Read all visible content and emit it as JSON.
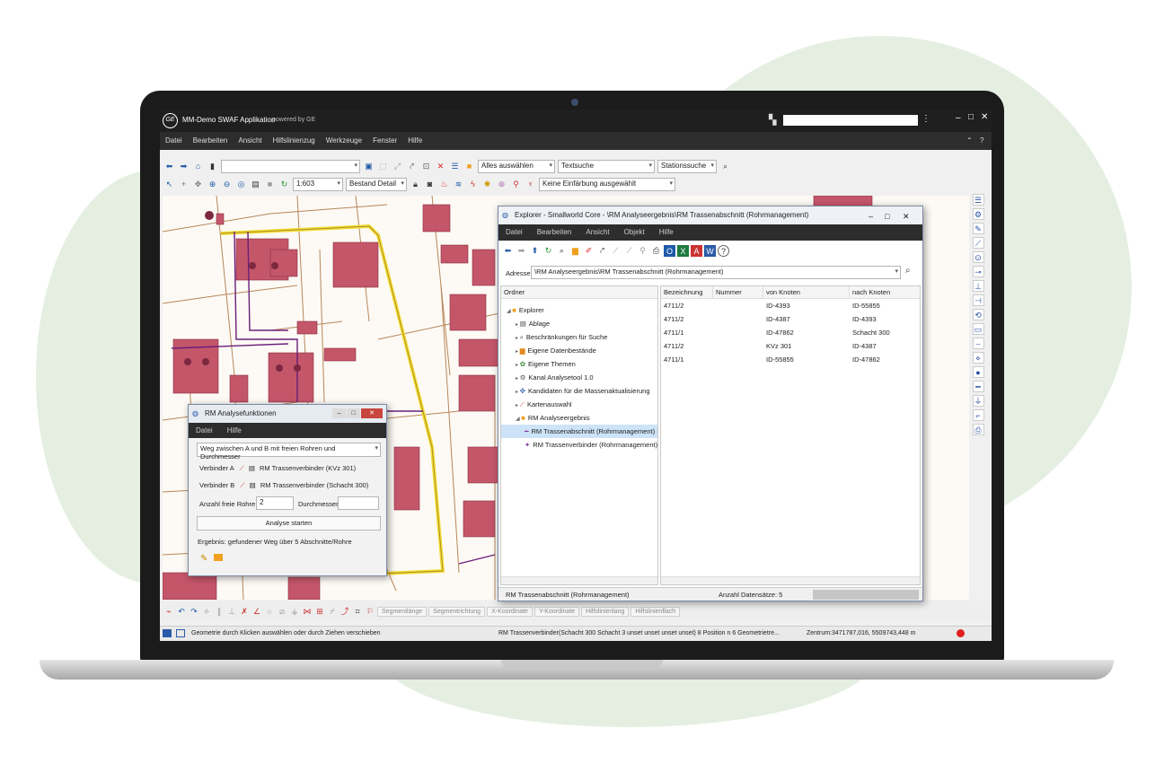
{
  "app": {
    "title": "MM-Demo SWAF Applikation",
    "subtitle": "powered by GE",
    "logo": "GE",
    "menu": [
      "Datei",
      "Bearbeiten",
      "Ansicht",
      "Hilfslinienzug",
      "Werkzeuge",
      "Fenster",
      "Hilfe"
    ]
  },
  "toolbar1": {
    "select_all": "Alles auswählen",
    "text_search": "Textsuche",
    "station_search": "Stationssuche"
  },
  "toolbar2": {
    "scale": "1:603",
    "view": "Bestand Detail",
    "coloring": "Keine Einfärbung ausgewählt"
  },
  "bottom_toolbar": {
    "tabs": [
      "Segmentlänge",
      "Segmentrichtung",
      "X-Koordinate",
      "Y-Koordinate",
      "Hilfslinienlang",
      "Hilfslinienflach"
    ]
  },
  "status": {
    "left": "Geometrie durch Klicken auswählen oder durch Ziehen verschieben",
    "middle": "RM Trassenverbinder(Schacht 300 Schacht 3 unset unset unset unset) 8 Position n 6 Geometrietre...",
    "right": "Zentrum:3471787,016, 5509743,448 m"
  },
  "analysis": {
    "title": "RM Analysefunktionen",
    "menu": [
      "Datei",
      "Hilfe"
    ],
    "mode": "Weg zwischen A und B mit freien Rohren und Durchmesser",
    "connector_a_label": "Verbinder A",
    "connector_a_value": "RM Trassenverbinder (KVz 301)",
    "connector_b_label": "Verbinder B",
    "connector_b_value": "RM Trassenverbinder (Schacht 300)",
    "free_pipes_label": "Anzahl freie Rohre",
    "free_pipes_value": "2",
    "diameter_label": "Durchmesser",
    "diameter_value": "",
    "start_button": "Analyse starten",
    "result": "Ergebnis: gefundener Weg über 5 Abschnitte/Rohre"
  },
  "explorer": {
    "title": "Explorer - Smallworld Core - \\RM Analyseergebnis\\RM Trassenabschnitt (Rohrmanagement)",
    "menu": [
      "Datei",
      "Bearbeiten",
      "Ansicht",
      "Objekt",
      "Hilfe"
    ],
    "address_label": "Adresse",
    "address": "\\RM Analyseergebnis\\RM Trassenabschnitt (Rohrmanagement)",
    "folder_header": "Ordner",
    "tree": [
      {
        "label": "Explorer",
        "icon": "folder-icon",
        "level": 0
      },
      {
        "label": "Ablage",
        "icon": "stack-icon",
        "level": 1
      },
      {
        "label": "Beschränkungen für Suche",
        "icon": "search-icon",
        "level": 1
      },
      {
        "label": "Eigene Datenbestände",
        "icon": "database-icon",
        "level": 1
      },
      {
        "label": "Eigene Themen",
        "icon": "themes-icon",
        "level": 1
      },
      {
        "label": "Kanal Analysetool 1.0",
        "icon": "network-icon",
        "level": 1
      },
      {
        "label": "Kandidaten für die Massenaktualisierung",
        "icon": "candidates-icon",
        "level": 1
      },
      {
        "label": "Kartenauswahl",
        "icon": "map-select-icon",
        "level": 1
      },
      {
        "label": "RM Analyseergebnis",
        "icon": "folder-icon",
        "level": 1
      },
      {
        "label": "RM Trassenabschnitt (Rohrmanagement)",
        "icon": "segment-icon",
        "level": 2,
        "selected": true
      },
      {
        "label": "RM Trassenverbinder (Rohrmanagement)",
        "icon": "connector-icon",
        "level": 2
      }
    ],
    "columns": [
      "Bezeichnung",
      "Nummer",
      "von Knoten",
      "nach Knoten"
    ],
    "rows": [
      [
        "4711/2",
        "",
        "ID-4393",
        "ID-55855"
      ],
      [
        "4711/2",
        "",
        "ID-4387",
        "ID-4393"
      ],
      [
        "4711/1",
        "",
        "ID-47862",
        "Schacht 300"
      ],
      [
        "4711/2",
        "",
        "KVz 301",
        "ID-4387"
      ],
      [
        "4711/1",
        "",
        "ID-55855",
        "ID-47862"
      ]
    ],
    "status_left": "RM Trassenabschnitt (Rohrmanagement)",
    "status_count": "Anzahl Datensätze: 5"
  },
  "colors": {
    "building": "#c4566a",
    "trench_highlight": "#f2df3a",
    "pipe": "#6a1e7a",
    "parcel_line": "#b7865a"
  }
}
